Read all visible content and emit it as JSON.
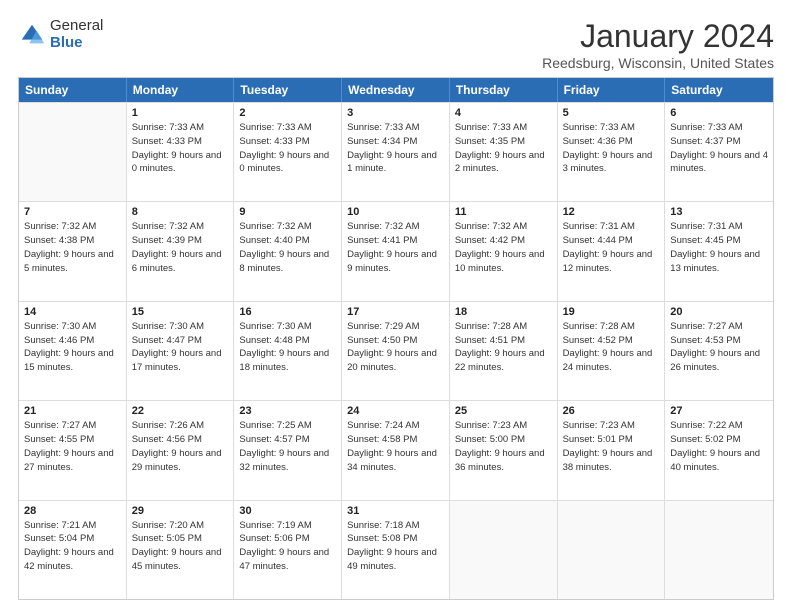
{
  "header": {
    "logo_general": "General",
    "logo_blue": "Blue",
    "title": "January 2024",
    "subtitle": "Reedsburg, Wisconsin, United States"
  },
  "weekdays": [
    "Sunday",
    "Monday",
    "Tuesday",
    "Wednesday",
    "Thursday",
    "Friday",
    "Saturday"
  ],
  "weeks": [
    [
      {
        "day": "",
        "sunrise": "",
        "sunset": "",
        "daylight": ""
      },
      {
        "day": "1",
        "sunrise": "Sunrise: 7:33 AM",
        "sunset": "Sunset: 4:33 PM",
        "daylight": "Daylight: 9 hours and 0 minutes."
      },
      {
        "day": "2",
        "sunrise": "Sunrise: 7:33 AM",
        "sunset": "Sunset: 4:33 PM",
        "daylight": "Daylight: 9 hours and 0 minutes."
      },
      {
        "day": "3",
        "sunrise": "Sunrise: 7:33 AM",
        "sunset": "Sunset: 4:34 PM",
        "daylight": "Daylight: 9 hours and 1 minute."
      },
      {
        "day": "4",
        "sunrise": "Sunrise: 7:33 AM",
        "sunset": "Sunset: 4:35 PM",
        "daylight": "Daylight: 9 hours and 2 minutes."
      },
      {
        "day": "5",
        "sunrise": "Sunrise: 7:33 AM",
        "sunset": "Sunset: 4:36 PM",
        "daylight": "Daylight: 9 hours and 3 minutes."
      },
      {
        "day": "6",
        "sunrise": "Sunrise: 7:33 AM",
        "sunset": "Sunset: 4:37 PM",
        "daylight": "Daylight: 9 hours and 4 minutes."
      }
    ],
    [
      {
        "day": "7",
        "sunrise": "Sunrise: 7:32 AM",
        "sunset": "Sunset: 4:38 PM",
        "daylight": "Daylight: 9 hours and 5 minutes."
      },
      {
        "day": "8",
        "sunrise": "Sunrise: 7:32 AM",
        "sunset": "Sunset: 4:39 PM",
        "daylight": "Daylight: 9 hours and 6 minutes."
      },
      {
        "day": "9",
        "sunrise": "Sunrise: 7:32 AM",
        "sunset": "Sunset: 4:40 PM",
        "daylight": "Daylight: 9 hours and 8 minutes."
      },
      {
        "day": "10",
        "sunrise": "Sunrise: 7:32 AM",
        "sunset": "Sunset: 4:41 PM",
        "daylight": "Daylight: 9 hours and 9 minutes."
      },
      {
        "day": "11",
        "sunrise": "Sunrise: 7:32 AM",
        "sunset": "Sunset: 4:42 PM",
        "daylight": "Daylight: 9 hours and 10 minutes."
      },
      {
        "day": "12",
        "sunrise": "Sunrise: 7:31 AM",
        "sunset": "Sunset: 4:44 PM",
        "daylight": "Daylight: 9 hours and 12 minutes."
      },
      {
        "day": "13",
        "sunrise": "Sunrise: 7:31 AM",
        "sunset": "Sunset: 4:45 PM",
        "daylight": "Daylight: 9 hours and 13 minutes."
      }
    ],
    [
      {
        "day": "14",
        "sunrise": "Sunrise: 7:30 AM",
        "sunset": "Sunset: 4:46 PM",
        "daylight": "Daylight: 9 hours and 15 minutes."
      },
      {
        "day": "15",
        "sunrise": "Sunrise: 7:30 AM",
        "sunset": "Sunset: 4:47 PM",
        "daylight": "Daylight: 9 hours and 17 minutes."
      },
      {
        "day": "16",
        "sunrise": "Sunrise: 7:30 AM",
        "sunset": "Sunset: 4:48 PM",
        "daylight": "Daylight: 9 hours and 18 minutes."
      },
      {
        "day": "17",
        "sunrise": "Sunrise: 7:29 AM",
        "sunset": "Sunset: 4:50 PM",
        "daylight": "Daylight: 9 hours and 20 minutes."
      },
      {
        "day": "18",
        "sunrise": "Sunrise: 7:28 AM",
        "sunset": "Sunset: 4:51 PM",
        "daylight": "Daylight: 9 hours and 22 minutes."
      },
      {
        "day": "19",
        "sunrise": "Sunrise: 7:28 AM",
        "sunset": "Sunset: 4:52 PM",
        "daylight": "Daylight: 9 hours and 24 minutes."
      },
      {
        "day": "20",
        "sunrise": "Sunrise: 7:27 AM",
        "sunset": "Sunset: 4:53 PM",
        "daylight": "Daylight: 9 hours and 26 minutes."
      }
    ],
    [
      {
        "day": "21",
        "sunrise": "Sunrise: 7:27 AM",
        "sunset": "Sunset: 4:55 PM",
        "daylight": "Daylight: 9 hours and 27 minutes."
      },
      {
        "day": "22",
        "sunrise": "Sunrise: 7:26 AM",
        "sunset": "Sunset: 4:56 PM",
        "daylight": "Daylight: 9 hours and 29 minutes."
      },
      {
        "day": "23",
        "sunrise": "Sunrise: 7:25 AM",
        "sunset": "Sunset: 4:57 PM",
        "daylight": "Daylight: 9 hours and 32 minutes."
      },
      {
        "day": "24",
        "sunrise": "Sunrise: 7:24 AM",
        "sunset": "Sunset: 4:58 PM",
        "daylight": "Daylight: 9 hours and 34 minutes."
      },
      {
        "day": "25",
        "sunrise": "Sunrise: 7:23 AM",
        "sunset": "Sunset: 5:00 PM",
        "daylight": "Daylight: 9 hours and 36 minutes."
      },
      {
        "day": "26",
        "sunrise": "Sunrise: 7:23 AM",
        "sunset": "Sunset: 5:01 PM",
        "daylight": "Daylight: 9 hours and 38 minutes."
      },
      {
        "day": "27",
        "sunrise": "Sunrise: 7:22 AM",
        "sunset": "Sunset: 5:02 PM",
        "daylight": "Daylight: 9 hours and 40 minutes."
      }
    ],
    [
      {
        "day": "28",
        "sunrise": "Sunrise: 7:21 AM",
        "sunset": "Sunset: 5:04 PM",
        "daylight": "Daylight: 9 hours and 42 minutes."
      },
      {
        "day": "29",
        "sunrise": "Sunrise: 7:20 AM",
        "sunset": "Sunset: 5:05 PM",
        "daylight": "Daylight: 9 hours and 45 minutes."
      },
      {
        "day": "30",
        "sunrise": "Sunrise: 7:19 AM",
        "sunset": "Sunset: 5:06 PM",
        "daylight": "Daylight: 9 hours and 47 minutes."
      },
      {
        "day": "31",
        "sunrise": "Sunrise: 7:18 AM",
        "sunset": "Sunset: 5:08 PM",
        "daylight": "Daylight: 9 hours and 49 minutes."
      },
      {
        "day": "",
        "sunrise": "",
        "sunset": "",
        "daylight": ""
      },
      {
        "day": "",
        "sunrise": "",
        "sunset": "",
        "daylight": ""
      },
      {
        "day": "",
        "sunrise": "",
        "sunset": "",
        "daylight": ""
      }
    ]
  ]
}
